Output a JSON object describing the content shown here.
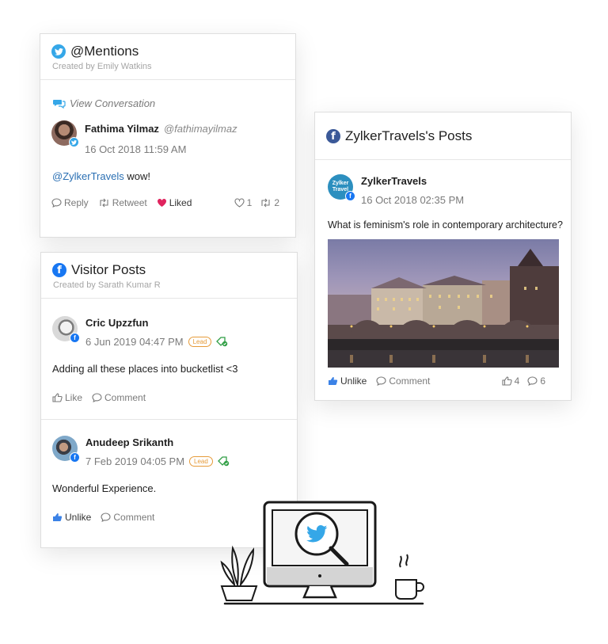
{
  "mentions_card": {
    "title": "@Mentions",
    "subtitle": "Created by Emily Watkins",
    "conversation_link": "View Conversation",
    "post": {
      "author": "Fathima Yilmaz",
      "handle": "@fathimayilmaz",
      "timestamp": "16 Oct 2018 11:59 AM",
      "mention": "@ZylkerTravels",
      "text": " wow!",
      "actions": {
        "reply": "Reply",
        "retweet": "Retweet",
        "liked": "Liked"
      },
      "counts": {
        "likes": "1",
        "retweets": "2"
      }
    }
  },
  "visitor_card": {
    "title": "Visitor Posts",
    "subtitle": "Created by Sarath Kumar R",
    "posts": [
      {
        "author": "Cric Upzzfun",
        "timestamp": "6 Jun 2019 04:47 PM",
        "badge": "Lead",
        "text": "Adding all these places into bucketlist <3",
        "actions": {
          "like": "Like",
          "comment": "Comment"
        }
      },
      {
        "author": "Anudeep Srikanth",
        "timestamp": "7 Feb 2019 04:05 PM",
        "badge": "Lead",
        "text": "Wonderful Experience.",
        "actions": {
          "like": "Unlike",
          "comment": "Comment"
        }
      }
    ]
  },
  "zylker_card": {
    "title": "ZylkerTravels's Posts",
    "post": {
      "author": "ZylkerTravels",
      "avatar_text": "Zylker Travel",
      "timestamp": "16 Oct 2018 02:35 PM",
      "text": "What is feminism's role in contemporary architecture?",
      "actions": {
        "like": "Unlike",
        "comment": "Comment"
      },
      "counts": {
        "likes": "4",
        "comments": "6"
      }
    }
  },
  "colors": {
    "twitter": "#35a7e8",
    "facebook": "#1877f2",
    "liked_heart": "#e0245e",
    "lead_badge": "#e69b3a",
    "mention_link": "#2a6fb3"
  }
}
